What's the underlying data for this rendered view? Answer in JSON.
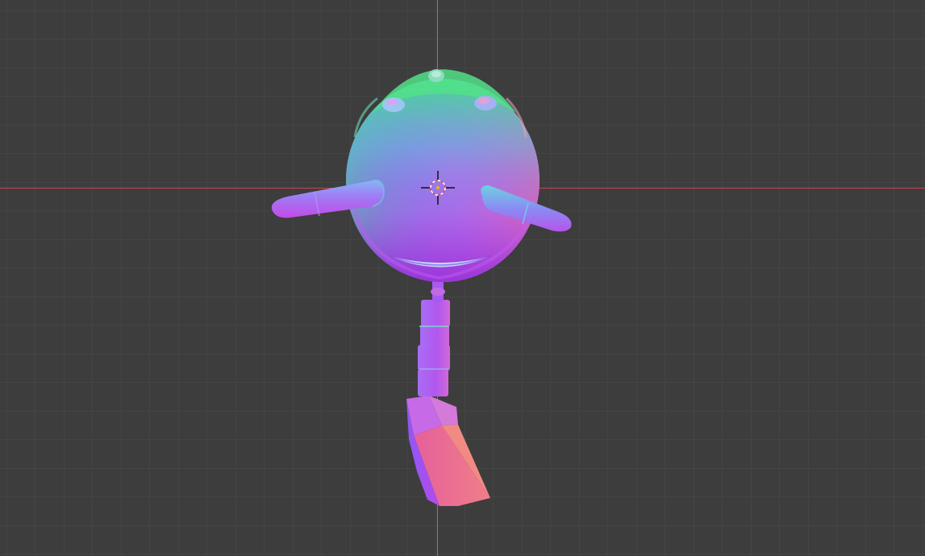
{
  "viewport": {
    "background_color": "#3d3d3d",
    "grid_line_color": "#4b4b4b",
    "x_axis_color": "#c9444d",
    "y_axis_color": "#6b9a2c",
    "view": "front-orthographic",
    "shading": "normal-map"
  },
  "scene_object": {
    "name": "character",
    "parts": [
      "head",
      "left-arm",
      "right-arm",
      "mouth",
      "neck",
      "spine",
      "leg",
      "foot",
      "top-knob",
      "left-eye",
      "right-eye"
    ]
  },
  "cursor": {
    "icon": "3d-cursor-icon"
  }
}
